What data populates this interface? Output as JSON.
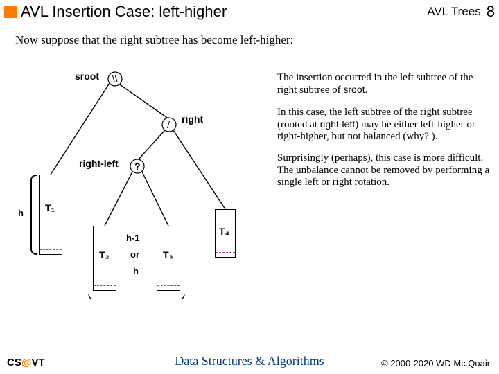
{
  "header": {
    "title": "AVL Insertion Case: left-higher",
    "topic": "AVL Trees",
    "page": "8"
  },
  "intro": "Now suppose that the right subtree has become left-higher:",
  "diagram": {
    "sroot": "sroot",
    "sroot_bal": "\\\\",
    "right": "right",
    "right_bal": "/",
    "rightleft": "right-left",
    "rightleft_bal": "?",
    "h": "h",
    "t1": "T₁",
    "t2": "T₂",
    "t3": "T₃",
    "t4": "T₄",
    "hminus": "h-1",
    "or": "or",
    "h2": "h"
  },
  "paras": {
    "p1a": "The insertion occurred in the left subtree of the right subtree of ",
    "p1b": "sroot",
    "p1c": ".",
    "p2a": "In this case, the left subtree of the right subtree (rooted at ",
    "p2b": "right-left",
    "p2c": ") may be either left-higher or right-higher, but not balanced (why? ).",
    "p3": "Surprisingly (perhaps), this case is more difficult.  The unbalance cannot be removed by performing a single left or right rotation."
  },
  "footer": {
    "cs": "CS",
    "at": "@",
    "vt": "VT",
    "center": "Data Structures & Algorithms",
    "right": "© 2000-2020 WD Mc.Quain"
  }
}
